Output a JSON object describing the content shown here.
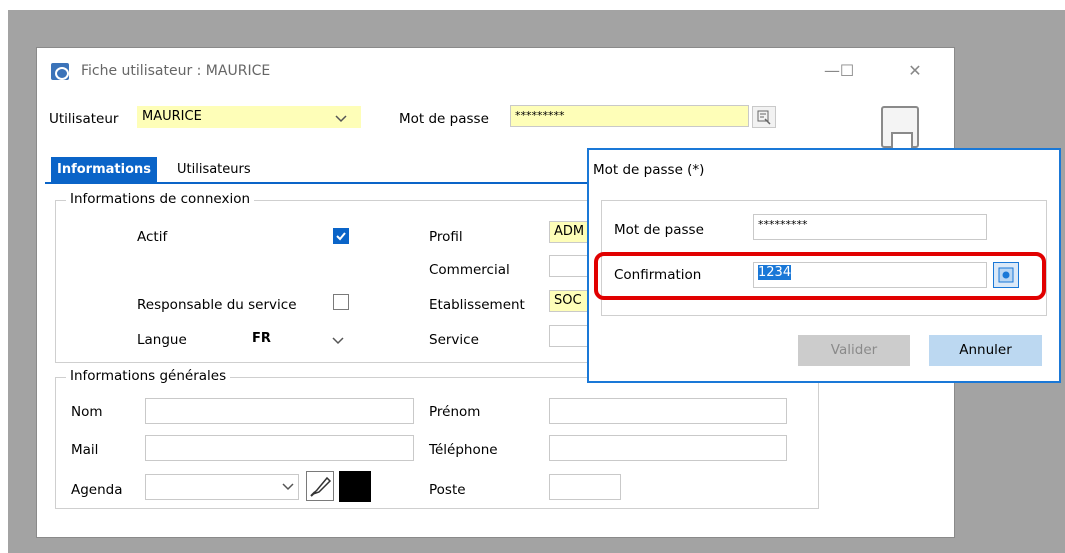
{
  "window": {
    "title": "Fiche utilisateur : MAURICE",
    "minimize": "—",
    "maximize": "☐",
    "close": "✕"
  },
  "header": {
    "user_label": "Utilisateur",
    "user_value": "MAURICE",
    "password_label": "Mot de passe",
    "password_value": "*********"
  },
  "tabs": [
    {
      "label": "Informations",
      "active": true
    },
    {
      "label": "Utilisateurs",
      "active": false
    }
  ],
  "connexion": {
    "group_title": "Informations de connexion",
    "actif_label": "Actif",
    "actif_checked": true,
    "responsable_label": "Responsable du service",
    "responsable_checked": false,
    "langue_label": "Langue",
    "langue_value": "FR",
    "profil_label": "Profil",
    "profil_value": "ADM",
    "commercial_label": "Commercial",
    "etablissement_label": "Etablissement",
    "etablissement_value": "SOC",
    "service_label": "Service"
  },
  "generales": {
    "group_title": "Informations générales",
    "nom_label": "Nom",
    "mail_label": "Mail",
    "agenda_label": "Agenda",
    "prenom_label": "Prénom",
    "telephone_label": "Téléphone",
    "poste_label": "Poste"
  },
  "dialog": {
    "title": "Mot de passe (*)",
    "password_label": "Mot de passe",
    "password_value": "*********",
    "confirm_label": "Confirmation",
    "confirm_value": "1234",
    "valider_label": "Valider",
    "annuler_label": "Annuler"
  },
  "colors": {
    "accent": "#0a64c8",
    "yellow_field": "#fefeb8",
    "highlight": "#e10000"
  }
}
